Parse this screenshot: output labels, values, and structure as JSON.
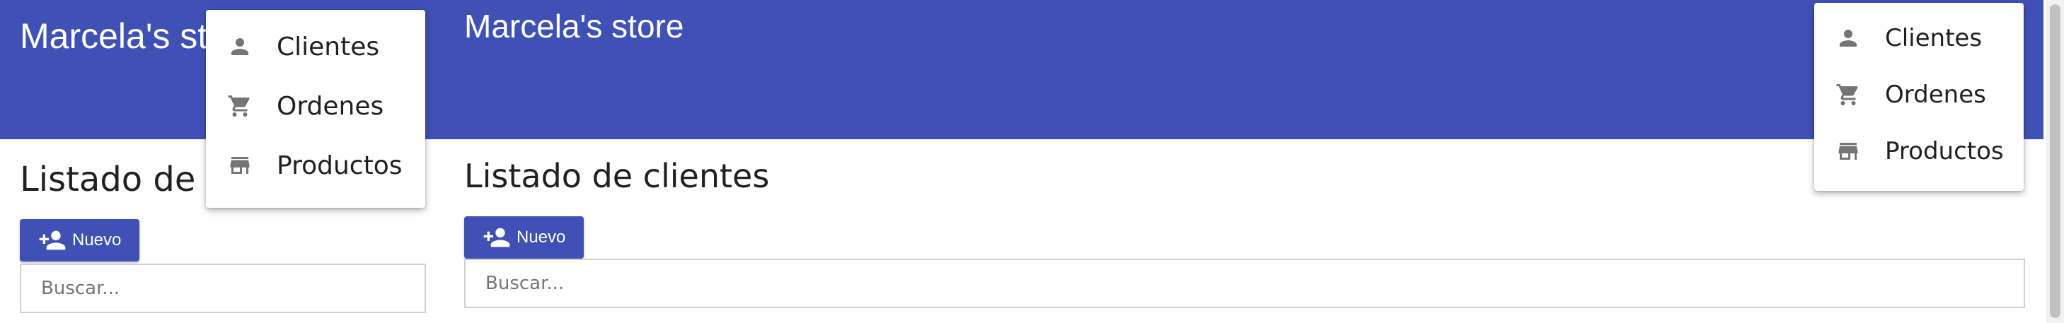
{
  "app": {
    "store_title": "Marcela's store",
    "store_title_cropped": "Marcela's s",
    "list_title": "Listado de clientes",
    "list_title_cropped": "Listado de c"
  },
  "actions": {
    "new_button_label": "Nuevo",
    "new_button_icon": "person-add-icon"
  },
  "search": {
    "placeholder": "Buscar...",
    "value": ""
  },
  "menu": {
    "items": [
      {
        "label": "Clientes",
        "icon": "person-icon"
      },
      {
        "label": "Ordenes",
        "icon": "shopping-cart-icon"
      },
      {
        "label": "Productos",
        "icon": "store-icon"
      }
    ]
  },
  "colors": {
    "primary": "#3f51b5",
    "icon_gray": "#757575",
    "text": "#212121"
  }
}
